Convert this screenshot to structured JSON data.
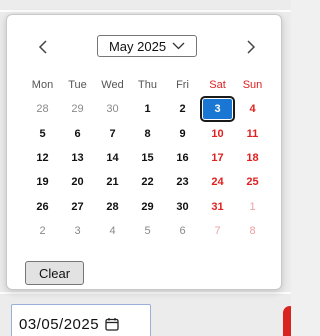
{
  "calendar": {
    "month_label": "May 2025",
    "weekdays": [
      "Mon",
      "Tue",
      "Wed",
      "Thu",
      "Fri",
      "Sat",
      "Sun"
    ],
    "weeks": [
      [
        "28",
        "29",
        "30",
        "1",
        "2",
        "3",
        "4"
      ],
      [
        "5",
        "6",
        "7",
        "8",
        "9",
        "10",
        "11"
      ],
      [
        "12",
        "13",
        "14",
        "15",
        "16",
        "17",
        "18"
      ],
      [
        "19",
        "20",
        "21",
        "22",
        "23",
        "24",
        "25"
      ],
      [
        "26",
        "27",
        "28",
        "29",
        "30",
        "31",
        "1"
      ],
      [
        "2",
        "3",
        "4",
        "5",
        "6",
        "7",
        "8"
      ]
    ],
    "muted": [
      [
        true,
        true,
        true,
        false,
        false,
        false,
        false
      ],
      [
        false,
        false,
        false,
        false,
        false,
        false,
        false
      ],
      [
        false,
        false,
        false,
        false,
        false,
        false,
        false
      ],
      [
        false,
        false,
        false,
        false,
        false,
        false,
        false
      ],
      [
        false,
        false,
        false,
        false,
        false,
        false,
        true
      ],
      [
        true,
        true,
        true,
        true,
        true,
        true,
        true
      ]
    ],
    "selected": {
      "week": 0,
      "day": 5
    },
    "clear_label": "Clear"
  },
  "date_input": {
    "value": "03/05/2025"
  },
  "colors": {
    "selected_bg": "#1976d2",
    "weekend_text": "#e02020",
    "weekend_header": "#e67a7a"
  },
  "icons": {
    "prev": "chevron-left-icon",
    "next": "chevron-right-icon",
    "dropdown": "chevron-down-icon",
    "calendar": "calendar-icon"
  }
}
